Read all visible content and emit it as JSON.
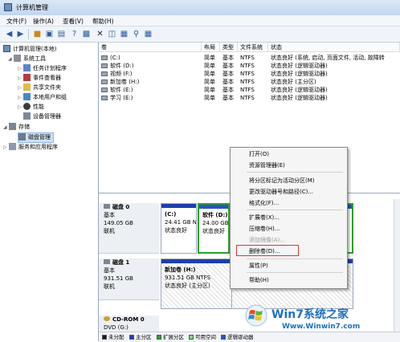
{
  "window": {
    "title": "计算机管理"
  },
  "menu": [
    "文件(F)",
    "操作(A)",
    "查看(V)",
    "帮助(H)"
  ],
  "tree": {
    "root": "计算机管理(本地)",
    "items": [
      {
        "label": "系统工具",
        "level": 1,
        "icon": "tools-icon"
      },
      {
        "label": "任务计划程序",
        "level": 2,
        "icon": "task-scheduler-icon"
      },
      {
        "label": "事件查看器",
        "level": 2,
        "icon": "event-viewer-icon"
      },
      {
        "label": "共享文件夹",
        "level": 2,
        "icon": "shared-folder-icon"
      },
      {
        "label": "本地用户和组",
        "level": 2,
        "icon": "users-icon"
      },
      {
        "label": "性能",
        "level": 2,
        "icon": "performance-icon"
      },
      {
        "label": "设备管理器",
        "level": 2,
        "icon": "device-manager-icon"
      },
      {
        "label": "存储",
        "level": 1,
        "icon": "storage-icon"
      },
      {
        "label": "磁盘管理",
        "level": 2,
        "icon": "disk-management-icon",
        "selected": true
      },
      {
        "label": "服务和应用程序",
        "level": 1,
        "icon": "services-icon"
      }
    ]
  },
  "volume_list": {
    "columns": [
      "卷",
      "布局",
      "类型",
      "文件系统",
      "状态"
    ],
    "rows": [
      [
        "(C:)",
        "简单",
        "基本",
        "NTFS",
        "状态良好 (系统, 启动, 页面文件, 活动, 故障转"
      ],
      [
        "软件 (D:)",
        "简单",
        "基本",
        "NTFS",
        "状态良好 (逻辑驱动器)"
      ],
      [
        "视频 (F:)",
        "简单",
        "基本",
        "NTFS",
        "状态良好 (逻辑驱动器)"
      ],
      [
        "新加卷 (H:)",
        "简单",
        "基本",
        "NTFS",
        "状态良好 (主分区)"
      ],
      [
        "软件 (E:)",
        "简单",
        "基本",
        "NTFS",
        "状态良好 (逻辑驱动器)"
      ],
      [
        "学习 (E:)",
        "简单",
        "基本",
        "NTFS",
        "状态良好 (逻辑驱动器)"
      ]
    ]
  },
  "disks": [
    {
      "name": "磁盘 0",
      "type": "基本",
      "size": "149.05 GB",
      "status": "联机",
      "partitions": [
        {
          "label": "(C:)",
          "size": "24.41 GB N",
          "status": "状态良好"
        },
        {
          "label": "软件 (D:)",
          "size": "24.00 GB",
          "status": "状态良好"
        }
      ]
    },
    {
      "name": "磁盘 1",
      "type": "基本",
      "size": "931.51 GB",
      "status": "联机",
      "partitions": [
        {
          "label": "新加卷 (H:)",
          "size": "931.51 GB NTFS",
          "status": "状态良好 (主分区)"
        }
      ]
    },
    {
      "name": "CD-ROM 0",
      "type": "DVD (G:)"
    }
  ],
  "legend": [
    {
      "label": "未分配",
      "color": "#1a1a1a"
    },
    {
      "label": "主分区",
      "color": "#1f3fa8"
    },
    {
      "label": "扩展分区",
      "color": "#2aa12a"
    },
    {
      "label": "可用空间",
      "color": "#7fd27f"
    },
    {
      "label": "逻辑驱动器",
      "color": "#2b52c6"
    }
  ],
  "context_menu": {
    "items": [
      {
        "label": "打开(O)",
        "disabled": false
      },
      {
        "label": "资源管理器(E)",
        "disabled": false
      },
      {
        "label": "将分区标记为活动分区(M)",
        "disabled": false
      },
      {
        "label": "更改驱动器号和路径(C)...",
        "disabled": false
      },
      {
        "label": "格式化(F)...",
        "disabled": false
      },
      {
        "label": "扩展卷(X)...",
        "disabled": false
      },
      {
        "label": "压缩卷(H)...",
        "disabled": false
      },
      {
        "label": "添加镜像(A)...",
        "disabled": true
      },
      {
        "label": "删除卷(D)...",
        "disabled": false,
        "highlighted": true
      },
      {
        "label": "属性(P)",
        "disabled": false
      },
      {
        "label": "帮助(H)",
        "disabled": false
      }
    ]
  },
  "watermark": {
    "brand": "Win7系统之家",
    "url": "Www.Winwin7.com"
  },
  "colors": {
    "primary": "#1f3fa8",
    "logical": "#2b52c6",
    "extended": "#2aa12a",
    "highlight": "#d23a3a"
  }
}
